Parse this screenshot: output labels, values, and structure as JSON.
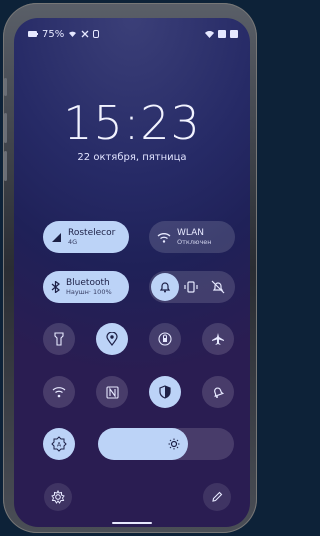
{
  "status_bar": {
    "battery": "75%"
  },
  "lockscreen": {
    "time": "15:23",
    "date": "22 октября, пятница"
  },
  "quick_tiles": {
    "mobile": {
      "title": "Rostelecor",
      "subtitle": "4G"
    },
    "wlan": {
      "title": "WLAN",
      "subtitle": "Отключен"
    },
    "bluetooth": {
      "title": "Bluetooth",
      "subtitle": "Наушн· 100%"
    }
  },
  "brightness": {
    "level": 0.66
  },
  "colors": {
    "accent": "#bcd3f7",
    "tile_off": "rgba(255,255,255,0.14)",
    "background": "#262a66"
  }
}
